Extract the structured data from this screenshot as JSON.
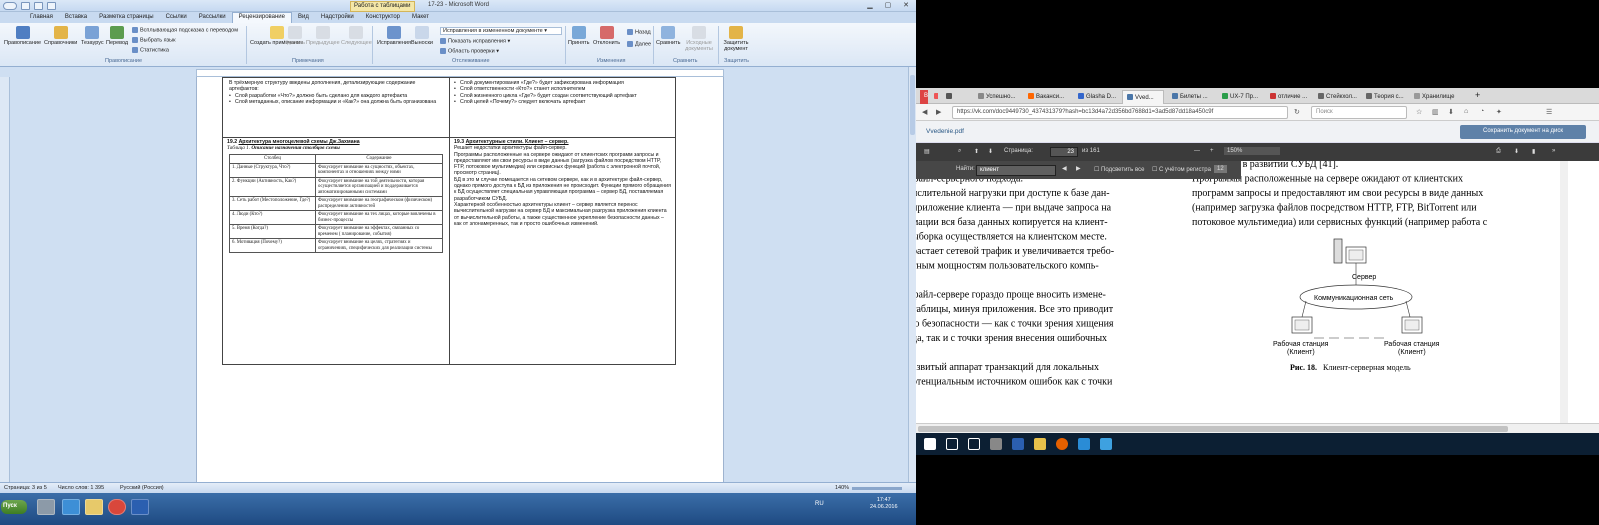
{
  "word": {
    "context_tab": "Работа с таблицами",
    "window_title": "17-23 - Microsoft Word",
    "tabs": [
      "Главная",
      "Вставка",
      "Разметка страницы",
      "Ссылки",
      "Рассылки",
      "Рецензирование",
      "Вид",
      "Надстройки",
      "Конструктор",
      "Макет"
    ],
    "active_tab": "Рецензирование",
    "ribbon": {
      "spelling": "Правописание",
      "research": "Справочники",
      "thesaurus": "Тезаурус",
      "translate": "Перевод",
      "tooltip_translate": "Всплывающая подсказка с переводом",
      "set_language": "Выбрать язык",
      "word_count": "Статистика",
      "group_proofing": "Правописание",
      "new_comment": "Создать примечание",
      "delete": "Удалить",
      "previous": "Предыдущее",
      "next": "Следующее",
      "group_comments": "Примечания",
      "track_changes": "Исправления",
      "balloons": "Выноски",
      "display_markup": "Исправления в измененном документе",
      "show_markup": "Показать исправления",
      "review_pane": "Область проверки",
      "group_tracking": "Отслеживание",
      "accept": "Принять",
      "reject": "Отклонить",
      "prev_change": "Назад",
      "next_change": "Далее",
      "group_changes": "Изменения",
      "compare": "Сравнить",
      "source_docs": "Исходные документы",
      "group_compare": "Сравнить",
      "protect": "Защитить документ",
      "group_protect": "Защитить"
    },
    "doc": {
      "top_left_intro": "В трёхмерную структуру введены дополнения, детализирующие содержание артефактов:",
      "top_left_items": [
        "Слой разработки «Что?» должно быть сделано для каждого артефакта",
        "Слой метаданных, описание информации и «Как?» она должна быть организована"
      ],
      "top_right_items": [
        "Слой документирования «Где?» будет зафиксирована информация",
        "Слой ответственности «Кто?» станет исполнителем",
        "Слой жизненного цикла «Где?» будет создан соответствующий артефакт",
        "Слой целей «Почему?» следует включать артефакт"
      ],
      "left_heading_num": "19.2",
      "left_heading": "Архитектура многоцелевой схемы Дж.Захмана",
      "table_caption_prefix": "Таблица 1.",
      "table_caption": "Описание назначения столбцов схемы",
      "table_header": [
        "Столбец",
        "Содержание"
      ],
      "table_rows": [
        [
          "1. Данные (Структура, Что?)",
          "Фокусирует внимание на сущностях, объектах, компонентах и отношениях между ними"
        ],
        [
          "2. Функции (Активность, Как?)",
          "Фокусирует внимание на той деятельности, которая осуществляется организацией и поддерживается автоматизированными системами"
        ],
        [
          "3. Сеть работ (Местоположение, Где?)",
          "Фокусирует внимание на географическом (физическом) распределении активностей"
        ],
        [
          "4. Люди (Кто?)",
          "Фокусирует внимание на тех лицах, которые вовлечены в бизнес-процессы"
        ],
        [
          "5. Время (Когда?)",
          "Фокусирует внимание на эффектах, связанных со временем ( планирование, события)"
        ],
        [
          "6. Мотивация (Почему?)",
          "Фокусирует внимание на целях, стратегиях и ограничениях, специфических для реализации системы"
        ]
      ],
      "right_heading_num": "19.3",
      "right_heading": "Архитектурные стили. Клиент – сервер.",
      "right_paragraphs": [
        "Решает недостатки архитектуры файл-сервер.",
        "Программы расположенные на сервере ожидают от клиентских программ запросы и предоставляют им свои ресурсы в виде данных (загрузка файлов посредством HTTP, FTP, потоковое мультимедиа) или сервисных функций (работа с электронной почтой, просмотр страниц).",
        "БД в это м случае помещается на сетевом сервере, как и в архитектуре файл-сервер, однако прямого доступа к БД из приложения не происходит. Функции прямого обращения к БД осуществляет специальная управляющая программа – сервер БД, поставляемая разработчиком СУБД.",
        "Характерной особенностью архитектуры клиент – сервер является перенос вычислительной нагрузки на сервер БД и максимальная разгрузка приложения клиента от вычислительной работы, а также существенное укрепление безопасности данных – как от злонамеренных, так и просто ошибочных изменений."
      ]
    },
    "status": {
      "page": "Страница: 3 из 5",
      "words": "Число слов: 1 395",
      "lang": "Русский (Россия)",
      "zoom": "140%"
    },
    "taskbar": {
      "start": "Пуск",
      "lang": "RU",
      "time": "17:47",
      "date": "24.06.2016"
    }
  },
  "firefox": {
    "tabs": [
      "Успешно...",
      "Ваканси...",
      "Glasha D...",
      "Vved...",
      "Билеты ...",
      "UX-7 Пр...",
      "отличие ...",
      "Стейкхол...",
      "Теория с...",
      "Хранилище"
    ],
    "active_tab_index": 3,
    "url": "https://vk.com/doc9449730_437431379?hash=bc13d4a72d356bd7688d1=3ad5d87dd18a450c9f",
    "search_placeholder": "Поиск",
    "vk_file": "Vvedenie.pdf",
    "vk_save": "Сохранить документ на диск",
    "pdf": {
      "page_label": "Страница:",
      "page_value": "23",
      "page_total": "из 161",
      "zoom": "150%",
      "find_label": "Найти:",
      "find_value": "клиент",
      "highlight_all": "Подсветить все",
      "match_case": "С учётом регистра",
      "match_count": "12",
      "left_lines": [
        "ли бизнес-логики. Централизованное  управление",
        "файл-серверного подхода:",
        "ислительной нагрузки при доступе к базе дан-",
        "приложение клиента — при выдаче запроса на",
        "мации вся база данных копируется на клиент-",
        "ыборка осуществляется на клиентском месте.",
        "растает сетевой трафик и увеличивается требо-",
        "тным мощностям пользовательского компь-",
        "",
        "файл-сервере гораздо проще вносить измене-",
        "таблицы, минуя приложения. Все это приводит",
        "ю безопасности — как с точки зрения хищения",
        "да, так и с точки зрения внесения ошибочных",
        "",
        "азвитый аппарат транзакций для локальных",
        "отенциальным источником ошибок как с точки"
      ],
      "right_lines": [
        "новый этап в развитии СУБД [41].",
        "Программы расположенные на сервере ожидают от клиентских",
        "программ запросы и предоставляют им свои ресурсы в виде данных",
        "(например загрузка файлов посредством HTTP, FTP, BitTorrent или",
        "потоковое мультимедиа) или сервисных функций (например работа с"
      ],
      "diagram": {
        "server": "Сервер",
        "network": "Коммуникационная сеть",
        "ws_left": "Рабочая станция",
        "ws_left_sub": "(Клиент)",
        "ws_right": "Рабочая станция",
        "ws_right_sub": "(Клиент)"
      },
      "figure_caption_prefix": "Рис. 18.",
      "figure_caption": "Клиент-серверная модель"
    }
  },
  "colors": {
    "word_ribbon": "#dbe7f5",
    "ff_toolbar": "#3b3b3b",
    "vk_button": "#5e81a8",
    "win10_taskbar": "#0c1f33"
  }
}
